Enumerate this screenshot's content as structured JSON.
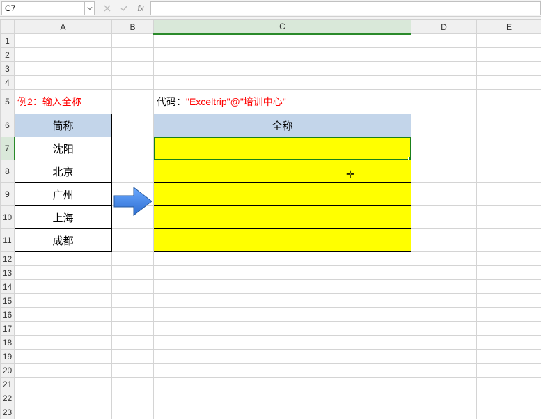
{
  "name_box": "C7",
  "formula": "",
  "columns": [
    "A",
    "B",
    "C",
    "D",
    "E"
  ],
  "rows": {
    "5": {
      "A": {
        "text": "例2：输入全称",
        "type": "red"
      },
      "C": {
        "prefix": "代码：",
        "code": "\"Exceltrip\"@\"培训中心\"",
        "type": "code"
      }
    },
    "6": {
      "A": {
        "text": "简称",
        "type": "header"
      },
      "C": {
        "text": "全称",
        "type": "header"
      }
    },
    "7": {
      "A": {
        "text": "沈阳",
        "type": "abbr"
      },
      "C": {
        "text": "",
        "type": "yellow",
        "active": true
      }
    },
    "8": {
      "A": {
        "text": "北京",
        "type": "abbr"
      },
      "C": {
        "text": "",
        "type": "yellow"
      }
    },
    "9": {
      "A": {
        "text": "广州",
        "type": "abbr"
      },
      "C": {
        "text": "",
        "type": "yellow"
      }
    },
    "10": {
      "A": {
        "text": "上海",
        "type": "abbr"
      },
      "C": {
        "text": "",
        "type": "yellow"
      }
    },
    "11": {
      "A": {
        "text": "成都",
        "type": "abbr"
      },
      "C": {
        "text": "",
        "type": "yellow"
      }
    }
  },
  "row_list": [
    1,
    2,
    3,
    4,
    5,
    6,
    7,
    8,
    9,
    10,
    11,
    12,
    13,
    14,
    15,
    16,
    17,
    18,
    19,
    20,
    21,
    22,
    23
  ],
  "tall_rows": [
    5,
    6,
    7,
    8,
    9,
    10,
    11
  ],
  "active_row": 7,
  "active_col": "C",
  "cursor_glyph": "✛"
}
